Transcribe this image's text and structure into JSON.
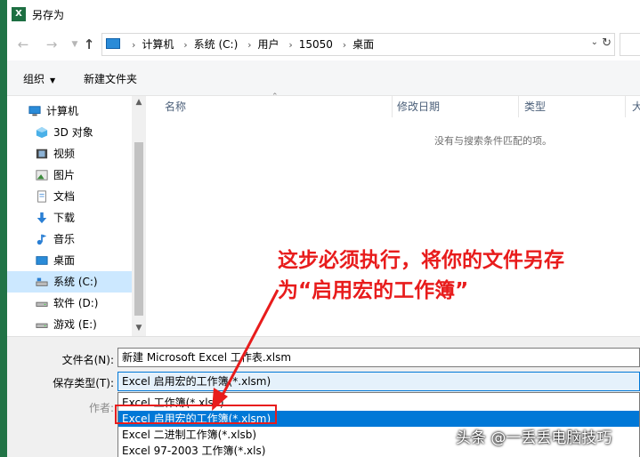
{
  "window": {
    "title": "另存为",
    "app_icon": "excel-icon"
  },
  "address": {
    "crumbs": [
      "计算机",
      "系统 (C:)",
      "用户",
      "15050",
      "桌面"
    ]
  },
  "toolbar": {
    "organize_label": "组织",
    "new_folder_label": "新建文件夹"
  },
  "navpane": {
    "items": [
      {
        "label": "计算机",
        "icon": "computer-icon"
      },
      {
        "label": "3D 对象",
        "icon": "cube-icon"
      },
      {
        "label": "视频",
        "icon": "video-icon"
      },
      {
        "label": "图片",
        "icon": "picture-icon"
      },
      {
        "label": "文档",
        "icon": "document-icon"
      },
      {
        "label": "下载",
        "icon": "download-icon"
      },
      {
        "label": "音乐",
        "icon": "music-icon"
      },
      {
        "label": "桌面",
        "icon": "desktop-icon"
      },
      {
        "label": "系统 (C:)",
        "icon": "drive-icon"
      },
      {
        "label": "软件 (D:)",
        "icon": "drive-icon"
      },
      {
        "label": "游戏 (E:)",
        "icon": "drive-icon"
      }
    ]
  },
  "filelist": {
    "columns": [
      "名称",
      "修改日期",
      "类型",
      "大"
    ],
    "empty_message": "没有与搜索条件匹配的项。"
  },
  "form": {
    "filename_label": "文件名(N):",
    "filename_value": "新建 Microsoft Excel 工作表.xlsm",
    "type_label": "保存类型(T):",
    "type_value": "Excel 启用宏的工作簿(*.xlsm)",
    "author_label": "作者:",
    "type_options": [
      "Excel 工作簿(*.xlsx)",
      "Excel 启用宏的工作簿(*.xlsm)",
      "Excel 二进制工作簿(*.xlsb)",
      "Excel 97-2003 工作簿(*.xls)"
    ]
  },
  "annotation": {
    "line1": "这步必须执行，将你的文件另存",
    "line2": "为“启用宏的工作簿”"
  },
  "watermark": "头条 @一丢丢电脑技巧",
  "colors": {
    "accent": "#0078d7",
    "annotation": "#e81c1c",
    "excel_green": "#217346"
  }
}
